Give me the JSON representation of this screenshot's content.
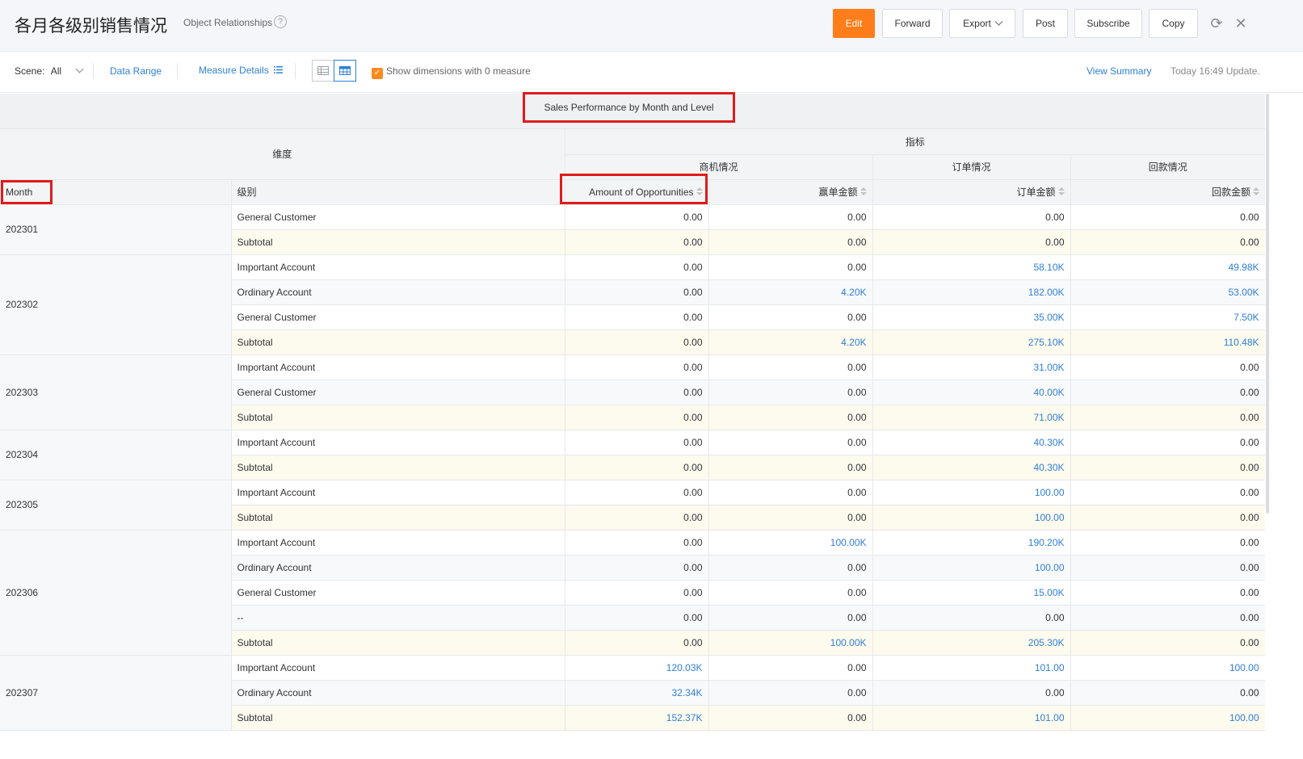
{
  "header": {
    "title": "各月各级别销售情况",
    "subtitle": "Object Relationships",
    "help": "?",
    "buttons": {
      "edit": "Edit",
      "forward": "Forward",
      "export": "Export",
      "post": "Post",
      "subscribe": "Subscribe",
      "copy": "Copy"
    },
    "refresh_icon": "⟳",
    "close_icon": "✕"
  },
  "toolbar": {
    "scene_label": "Scene:",
    "scene_value": "All",
    "data_range": "Data Range",
    "measure_details": "Measure Details",
    "show_dims_label": "Show dimensions with 0 measure",
    "view_summary": "View Summary",
    "update_time": "Today 16:49 Update."
  },
  "report": {
    "title": "Sales Performance by Month and Level",
    "dim_group": "维度",
    "measure_group": "指标",
    "groups": {
      "opportunity": "商机情况",
      "order": "订单情况",
      "payment": "回款情况"
    },
    "columns": {
      "month": "Month",
      "level": "级别",
      "opp_amount": "Amount of Opportunities",
      "signed_amount": "赢单金额",
      "order_amount": "订单金额",
      "payment_amount": "回款金额"
    },
    "rows": [
      {
        "month": "202301",
        "level": "General Customer",
        "opp": "0.00",
        "signed": "0.00",
        "order": "0.00",
        "pay": "0.00"
      },
      {
        "month": "",
        "level": "Subtotal",
        "opp": "0.00",
        "signed": "0.00",
        "order": "0.00",
        "pay": "0.00"
      },
      {
        "month": "202302",
        "level": "Important Account",
        "opp": "0.00",
        "signed": "0.00",
        "order": "58.10K",
        "pay": "49.98K"
      },
      {
        "month": "",
        "level": "Ordinary Account",
        "opp": "0.00",
        "signed": "4.20K",
        "order": "182.00K",
        "pay": "53.00K"
      },
      {
        "month": "",
        "level": "General Customer",
        "opp": "0.00",
        "signed": "0.00",
        "order": "35.00K",
        "pay": "7.50K"
      },
      {
        "month": "",
        "level": "Subtotal",
        "opp": "0.00",
        "signed": "4.20K",
        "order": "275.10K",
        "pay": "110.48K"
      },
      {
        "month": "202303",
        "level": "Important Account",
        "opp": "0.00",
        "signed": "0.00",
        "order": "31.00K",
        "pay": "0.00"
      },
      {
        "month": "",
        "level": "General Customer",
        "opp": "0.00",
        "signed": "0.00",
        "order": "40.00K",
        "pay": "0.00"
      },
      {
        "month": "",
        "level": "Subtotal",
        "opp": "0.00",
        "signed": "0.00",
        "order": "71.00K",
        "pay": "0.00"
      },
      {
        "month": "202304",
        "level": "Important Account",
        "opp": "0.00",
        "signed": "0.00",
        "order": "40.30K",
        "pay": "0.00"
      },
      {
        "month": "",
        "level": "Subtotal",
        "opp": "0.00",
        "signed": "0.00",
        "order": "40.30K",
        "pay": "0.00"
      },
      {
        "month": "202305",
        "level": "Important Account",
        "opp": "0.00",
        "signed": "0.00",
        "order": "100.00",
        "pay": "0.00"
      },
      {
        "month": "",
        "level": "Subtotal",
        "opp": "0.00",
        "signed": "0.00",
        "order": "100.00",
        "pay": "0.00"
      },
      {
        "month": "202306",
        "level": "Important Account",
        "opp": "0.00",
        "signed": "100.00K",
        "order": "190.20K",
        "pay": "0.00"
      },
      {
        "month": "",
        "level": "Ordinary Account",
        "opp": "0.00",
        "signed": "0.00",
        "order": "100.00",
        "pay": "0.00"
      },
      {
        "month": "",
        "level": "General Customer",
        "opp": "0.00",
        "signed": "0.00",
        "order": "15.00K",
        "pay": "0.00"
      },
      {
        "month": "",
        "level": "--",
        "opp": "0.00",
        "signed": "0.00",
        "order": "0.00",
        "pay": "0.00"
      },
      {
        "month": "",
        "level": "Subtotal",
        "opp": "0.00",
        "signed": "100.00K",
        "order": "205.30K",
        "pay": "0.00"
      },
      {
        "month": "202307",
        "level": "Important Account",
        "opp": "120.03K",
        "signed": "0.00",
        "order": "101.00",
        "pay": "100.00"
      },
      {
        "month": "",
        "level": "Ordinary Account",
        "opp": "32.34K",
        "signed": "0.00",
        "order": "0.00",
        "pay": "0.00"
      },
      {
        "month": "",
        "level": "Subtotal",
        "opp": "152.37K",
        "signed": "0.00",
        "order": "101.00",
        "pay": "100.00"
      }
    ]
  },
  "colors": {
    "accent": "#ff7d1a",
    "link": "#2f7fd7",
    "highlight": "#e01b1b",
    "subtotal_bg": "#fdfaee"
  }
}
